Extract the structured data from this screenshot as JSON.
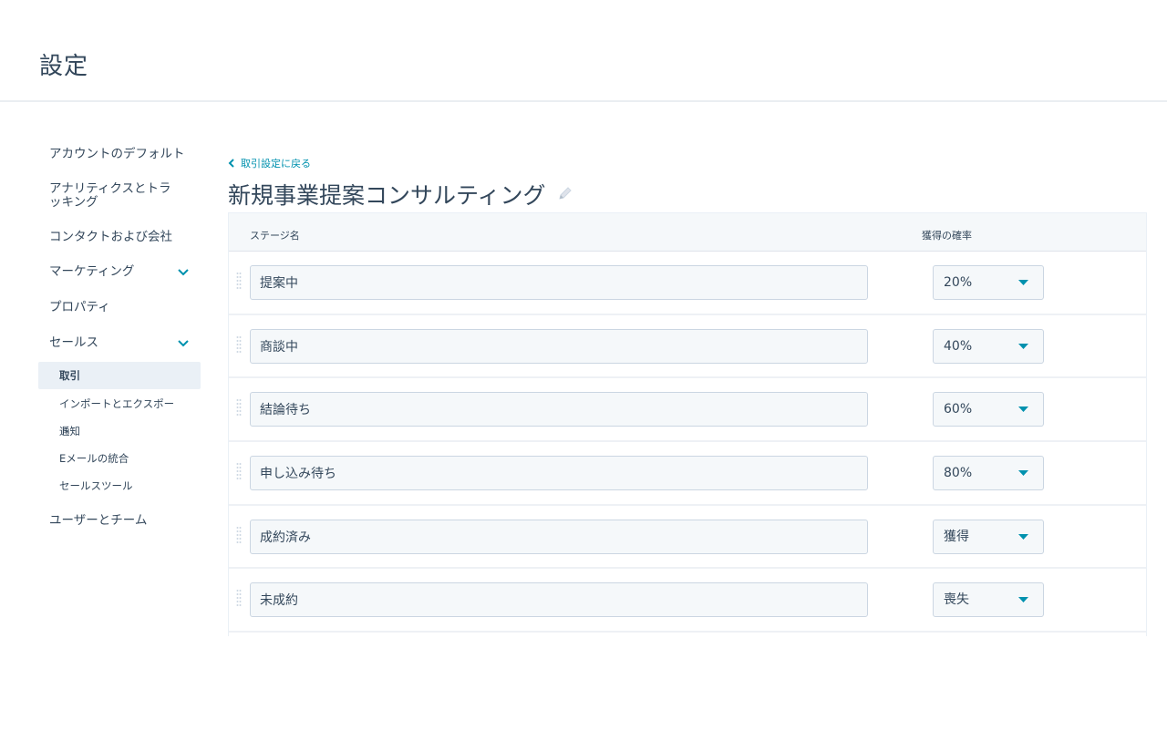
{
  "header": {
    "title": "設定"
  },
  "sidebar": {
    "items": [
      {
        "label": "アカウントのデフォルト"
      },
      {
        "label": "アナリティクスとトラッキング"
      },
      {
        "label": "コンタクトおよび会社"
      },
      {
        "label": "マーケティング",
        "icon": "chevron-down-icon"
      },
      {
        "label": "プロパティ"
      },
      {
        "label": "セールス",
        "icon": "chevron-down-icon"
      }
    ],
    "sales_sub_items": [
      {
        "label": "取引",
        "active": true
      },
      {
        "label": "インポートとエクスポート"
      },
      {
        "label": "通知"
      },
      {
        "label": "Eメールの統合"
      },
      {
        "label": "セールスツール"
      }
    ],
    "last_item": {
      "label": "ユーザーとチーム"
    }
  },
  "main": {
    "back_link": "取引設定に戻る",
    "title": "新規事業提案コンサルティング",
    "table": {
      "col_stage": "ステージ名",
      "col_probability": "獲得の確率",
      "rows": [
        {
          "stage": "提案中",
          "probability": "20%"
        },
        {
          "stage": "商談中",
          "probability": "40%"
        },
        {
          "stage": "結論待ち",
          "probability": "60%"
        },
        {
          "stage": "申し込み待ち",
          "probability": "80%"
        },
        {
          "stage": "成約済み",
          "probability": "獲得"
        },
        {
          "stage": "未成約",
          "probability": "喪失"
        }
      ]
    }
  },
  "colors": {
    "accent": "#0091ae",
    "text": "#33475b",
    "border": "#cbd6e2",
    "input_bg": "#f5f8fa",
    "active_bg": "#eaf0f6"
  }
}
